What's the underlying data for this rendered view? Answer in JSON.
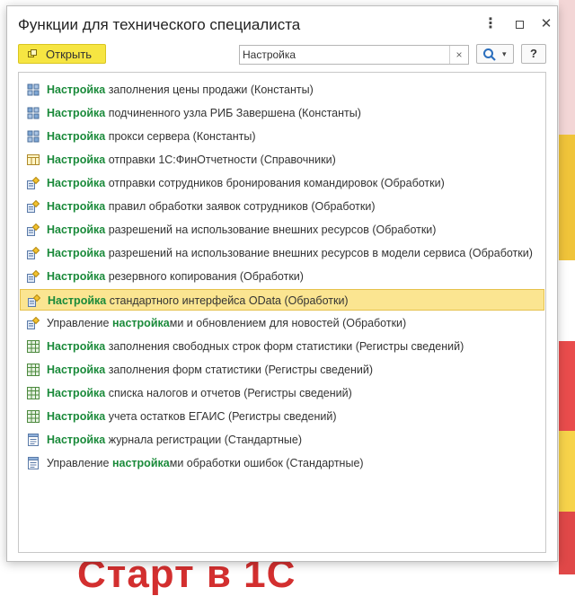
{
  "window": {
    "title": "Функции для технического специалиста",
    "more_label": "⋮",
    "close_label": "✕"
  },
  "toolbar": {
    "open_label": "Открыть",
    "search_value": "Настройка",
    "clear_label": "×",
    "dropdown_label": "▾",
    "help_label": "?"
  },
  "items": [
    {
      "icon": "constant-icon",
      "pre": "",
      "match": "Настройка",
      "post": " заполнения цены продажи (Константы)"
    },
    {
      "icon": "constant-icon",
      "pre": "",
      "match": "Настройка",
      "post": " подчиненного узла РИБ Завершена (Константы)"
    },
    {
      "icon": "constant-icon",
      "pre": "",
      "match": "Настройка",
      "post": " прокси сервера (Константы)"
    },
    {
      "icon": "catalog-icon",
      "pre": "",
      "match": "Настройка",
      "post": " отправки 1С:ФинОтчетности (Справочники)"
    },
    {
      "icon": "dataprocessor-icon",
      "pre": "",
      "match": "Настройка",
      "post": " отправки сотрудников бронирования командировок (Обработки)"
    },
    {
      "icon": "dataprocessor-icon",
      "pre": "",
      "match": "Настройка",
      "post": " правил обработки заявок сотрудников (Обработки)"
    },
    {
      "icon": "dataprocessor-icon",
      "pre": "",
      "match": "Настройка",
      "post": " разрешений на использование внешних ресурсов (Обработки)"
    },
    {
      "icon": "dataprocessor-icon",
      "pre": "",
      "match": "Настройка",
      "post": " разрешений на использование внешних ресурсов в модели сервиса (Обработки)"
    },
    {
      "icon": "dataprocessor-icon",
      "pre": "",
      "match": "Настройка",
      "post": " резервного копирования (Обработки)"
    },
    {
      "icon": "dataprocessor-icon",
      "pre": "",
      "match": "Настройка",
      "post": " стандартного интерфейса OData (Обработки)",
      "selected": true
    },
    {
      "icon": "dataprocessor-icon",
      "pre": "Управление ",
      "match": "настройка",
      "post": "ми и обновлением для новостей (Обработки)"
    },
    {
      "icon": "register-icon",
      "pre": "",
      "match": "Настройка",
      "post": " заполнения свободных строк форм статистики (Регистры сведений)"
    },
    {
      "icon": "register-icon",
      "pre": "",
      "match": "Настройка",
      "post": " заполнения форм статистики (Регистры сведений)"
    },
    {
      "icon": "register-icon",
      "pre": "",
      "match": "Настройка",
      "post": " списка налогов и отчетов (Регистры сведений)"
    },
    {
      "icon": "register-icon",
      "pre": "",
      "match": "Настройка",
      "post": " учета остатков ЕГАИС (Регистры сведений)"
    },
    {
      "icon": "standard-icon",
      "pre": "",
      "match": "Настройка",
      "post": " журнала регистрации (Стандартные)"
    },
    {
      "icon": "standard-icon",
      "pre": "Управление ",
      "match": "настройка",
      "post": "ми обработки ошибок (Стандартные)"
    }
  ],
  "background": {
    "bottom_text": "Старт в 1С"
  },
  "colors": {
    "accent_yellow": "#f6e542",
    "match_green": "#1a8a3a",
    "selection": "#fbe591"
  }
}
